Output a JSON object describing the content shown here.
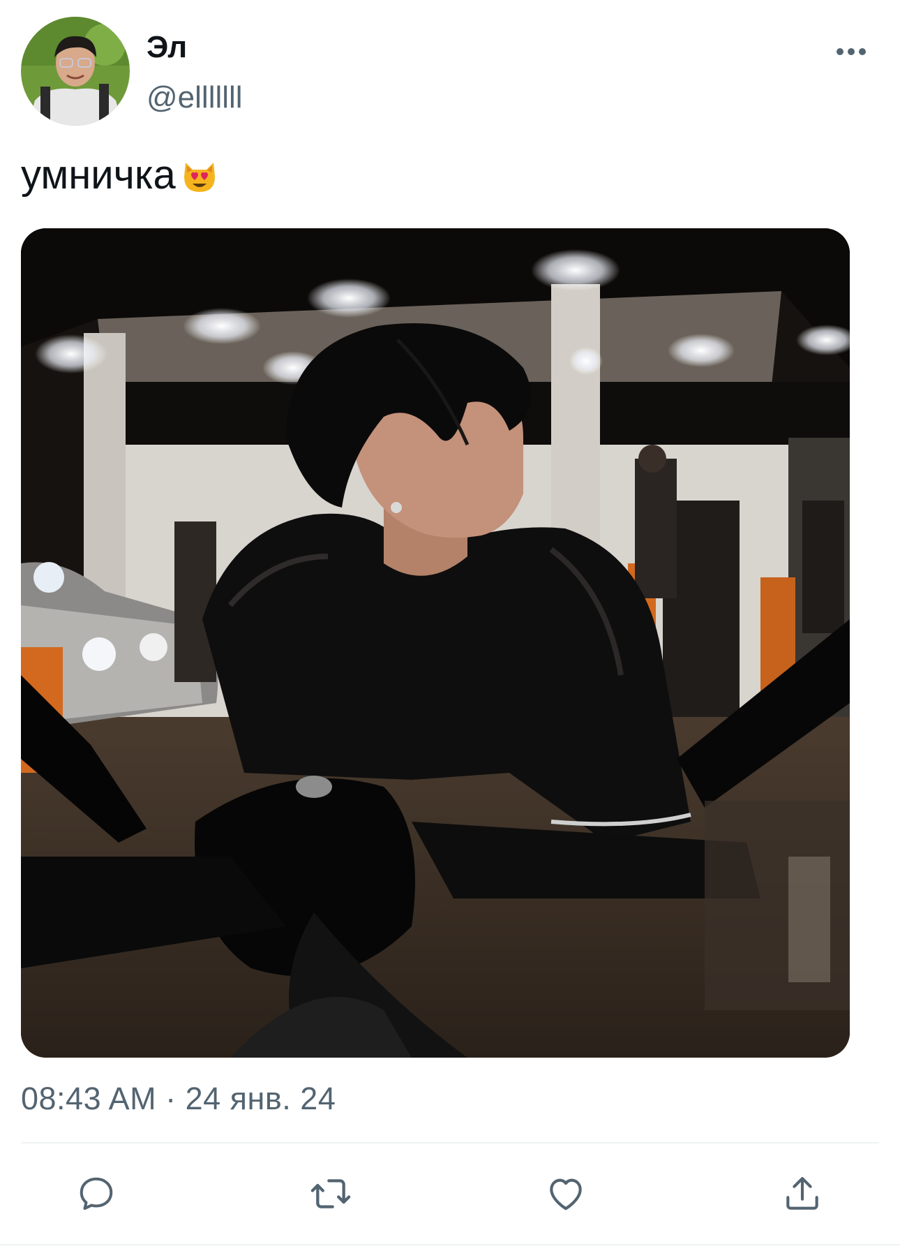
{
  "author": {
    "display_name": "Эл",
    "handle": "@elllllll",
    "avatar_icon": "avatar-photo"
  },
  "menu": {
    "icon": "more-dots-icon"
  },
  "tweet": {
    "text": "умничка",
    "emoji": "smiling-cat-heart-eyes"
  },
  "media": {
    "description_icon": "photo-media"
  },
  "meta": {
    "timestamp": "08:43 AM · 24 янв. 24"
  },
  "actions": [
    {
      "name": "reply",
      "icon": "reply-icon"
    },
    {
      "name": "retweet",
      "icon": "retweet-icon"
    },
    {
      "name": "like",
      "icon": "like-icon"
    },
    {
      "name": "share",
      "icon": "share-icon"
    }
  ],
  "colors": {
    "text_primary": "#0f1419",
    "text_secondary": "#536471",
    "divider": "#eff3f4",
    "icon": "#536471"
  }
}
